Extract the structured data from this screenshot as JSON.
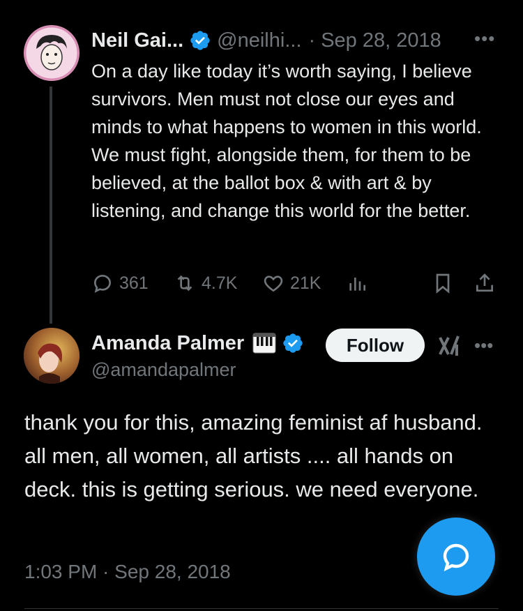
{
  "tweet1": {
    "author_name": "Neil Gai...",
    "handle": "@neilhi...",
    "date": "· Sep 28, 2018",
    "more": "•••",
    "text": "On a day like today it’s worth saying, I believe survivors. Men must not close our eyes and minds to what happens to women in this world. We must fight, alongside them, for them to be believed, at the ballot box & with art & by listening, and change this world for the better.",
    "replies": "361",
    "retweets": "4.7K",
    "likes": "21K"
  },
  "tweet2": {
    "author_name": "Amanda Palmer",
    "handle": "@amandapalmer",
    "follow_label": "Follow",
    "more": "•••",
    "text": "thank you for this, amazing feminist af husband. all men, all women, all artists .... all hands on deck. this is getting serious. we need everyone.",
    "timestamp": "1:03 PM · Sep 28, 2018"
  },
  "colors": {
    "background": "#000000",
    "text": "#e7e9ea",
    "muted": "#71767b",
    "verified": "#1d9bf0",
    "fab": "#1d9bf0"
  }
}
